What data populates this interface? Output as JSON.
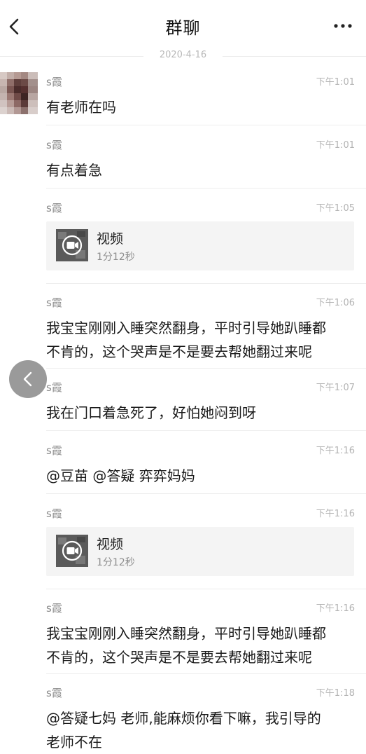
{
  "header": {
    "title": "群聊",
    "back_icon": "chevron-left-icon",
    "more_icon": "more-dots-icon"
  },
  "date_separator": "2020-4-16",
  "messages": [
    {
      "sender": "s霞",
      "time": "下午1:01",
      "text": "有老师在吗"
    },
    {
      "sender": "s霞",
      "time": "下午1:01",
      "text": "有点着急"
    },
    {
      "sender": "s霞",
      "time": "下午1:05",
      "video": {
        "label": "视频",
        "duration": "1分12秒"
      }
    },
    {
      "sender": "s霞",
      "time": "下午1:06",
      "lines": [
        "我宝宝刚刚入睡突然翻身，平时引导她趴睡都",
        "不肯的，这个哭声是不是要去帮她翻过来呢"
      ]
    },
    {
      "sender": "s霞",
      "time": "下午1:07",
      "text": "我在门口着急死了，好怕她闷到呀"
    },
    {
      "sender": "s霞",
      "time": "下午1:16",
      "text": "@豆苗 @答疑 弈弈妈妈"
    },
    {
      "sender": "s霞",
      "time": "下午1:16",
      "video": {
        "label": "视频",
        "duration": "1分12秒"
      }
    },
    {
      "sender": "s霞",
      "time": "下午1:16",
      "lines": [
        "我宝宝刚刚入睡突然翻身，平时引导她趴睡都",
        "不肯的，这个哭声是不是要去帮她翻过来呢"
      ]
    },
    {
      "sender": "s霞",
      "time": "下午1:18",
      "lines": [
        "@答疑七妈 老师,能麻烦你看下嘛，我引导的",
        "老师不在"
      ]
    }
  ],
  "floating_button": {
    "icon": "chevron-left-icon"
  }
}
